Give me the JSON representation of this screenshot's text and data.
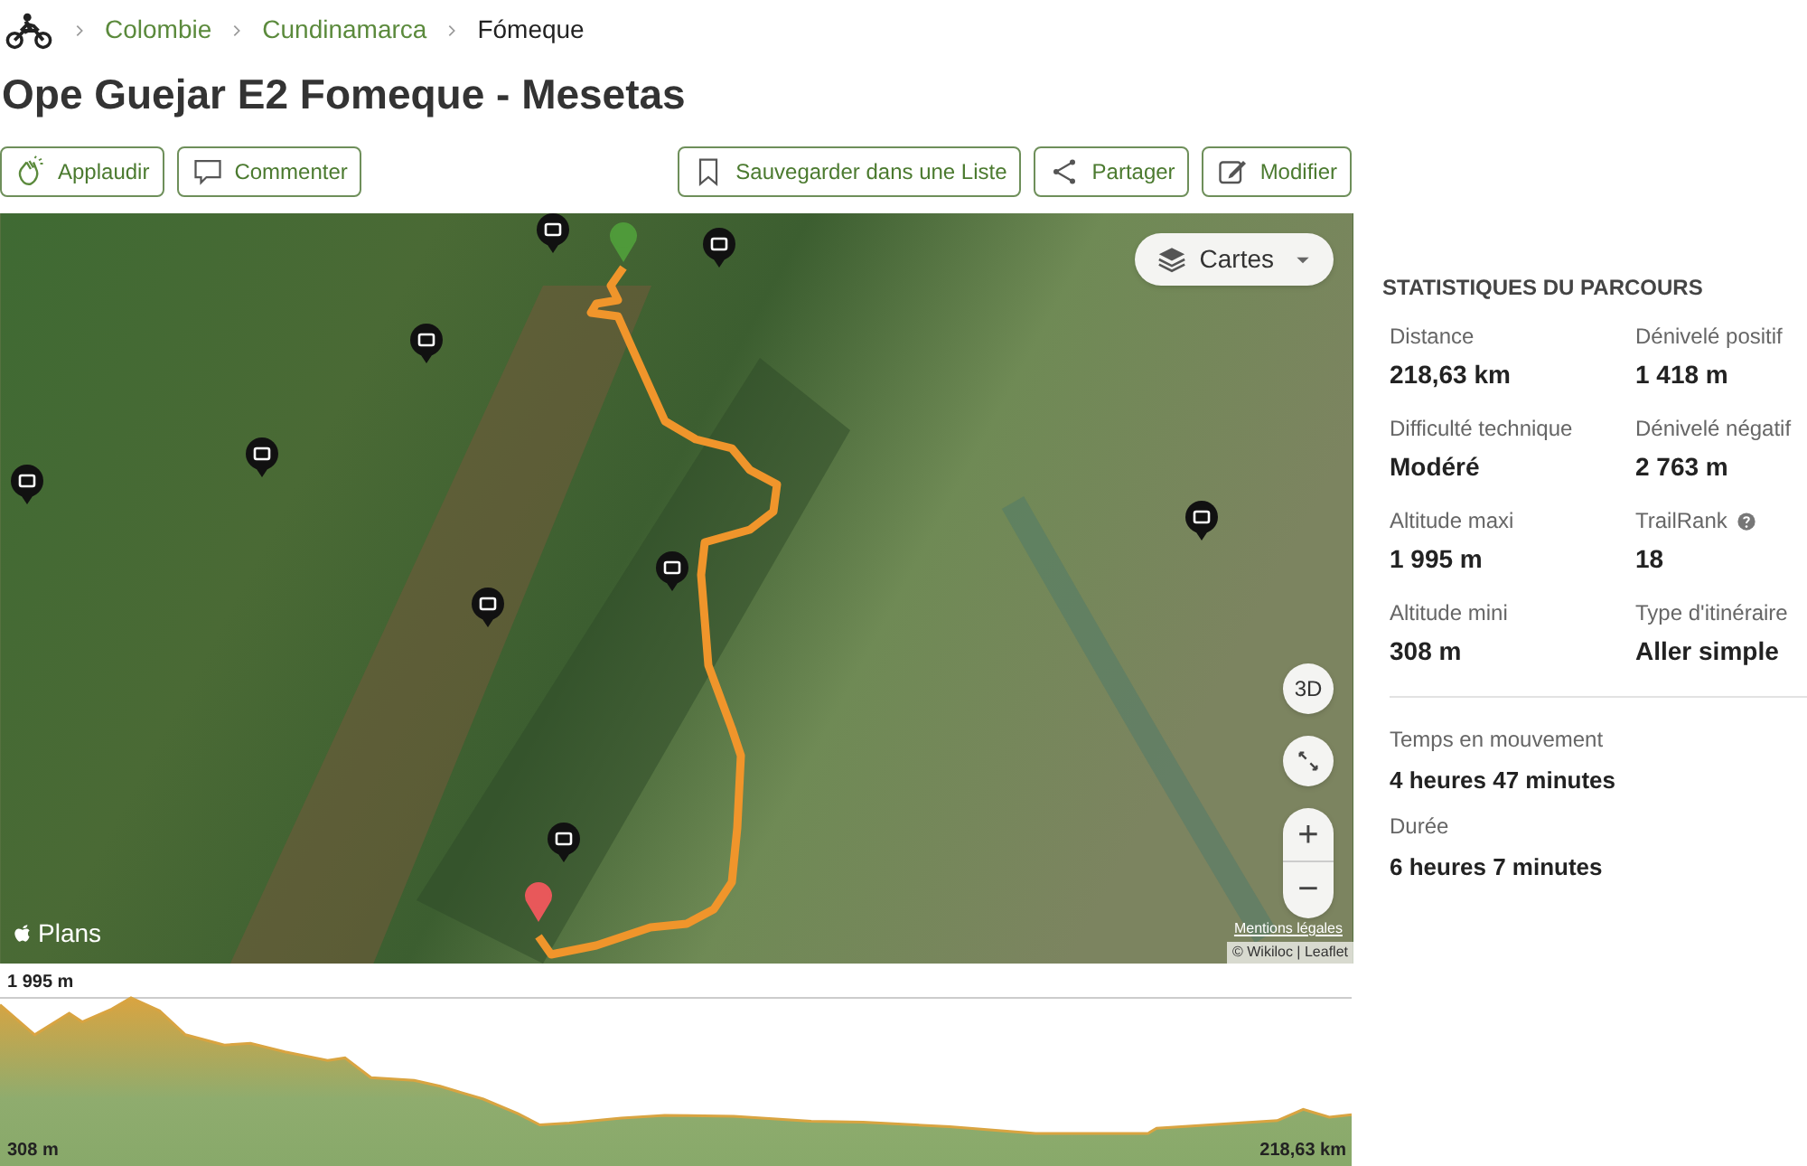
{
  "breadcrumb": [
    {
      "label": "Colombie",
      "link": true
    },
    {
      "label": "Cundinamarca",
      "link": true
    },
    {
      "label": "Fómeque",
      "link": false
    }
  ],
  "title": "Ope Guejar E2 Fomeque - Mesetas",
  "actions_left": [
    {
      "kind": "applaud",
      "label": "Applaudir"
    },
    {
      "kind": "comment",
      "label": "Commenter"
    }
  ],
  "actions_right": [
    {
      "kind": "save",
      "label": "Sauvegarder dans une Liste"
    },
    {
      "kind": "share",
      "label": "Partager"
    },
    {
      "kind": "edit",
      "label": "Modifier"
    }
  ],
  "map": {
    "layers_button": "Cartes",
    "btn_3d": "3D",
    "zoom_in": "+",
    "zoom_out": "−",
    "provider": "Plans",
    "legal": "Mentions légales",
    "attribution": "© Wikiloc | Leaflet"
  },
  "elevation": {
    "max_label": "1 995 m",
    "min_label": "308 m",
    "distance_label": "218,63 km"
  },
  "stats": {
    "heading": "STATISTIQUES DU PARCOURS",
    "items": [
      {
        "label": "Distance",
        "value": "218,63 km",
        "help": false
      },
      {
        "label": "Dénivelé positif",
        "value": "1 418 m",
        "help": false
      },
      {
        "label": "Difficulté technique",
        "value": "Modéré",
        "help": false
      },
      {
        "label": "Dénivelé négatif",
        "value": "2 763 m",
        "help": false
      },
      {
        "label": "Altitude maxi",
        "value": "1 995 m",
        "help": false
      },
      {
        "label": "TrailRank",
        "value": "18",
        "help": true
      },
      {
        "label": "Altitude mini",
        "value": "308 m",
        "help": false
      },
      {
        "label": "Type d'itinéraire",
        "value": "Aller simple",
        "help": false
      }
    ],
    "times": [
      {
        "label": "Temps en mouvement",
        "value": "4 heures 47 minutes"
      },
      {
        "label": "Durée",
        "value": "6 heures 7 minutes"
      }
    ]
  }
}
